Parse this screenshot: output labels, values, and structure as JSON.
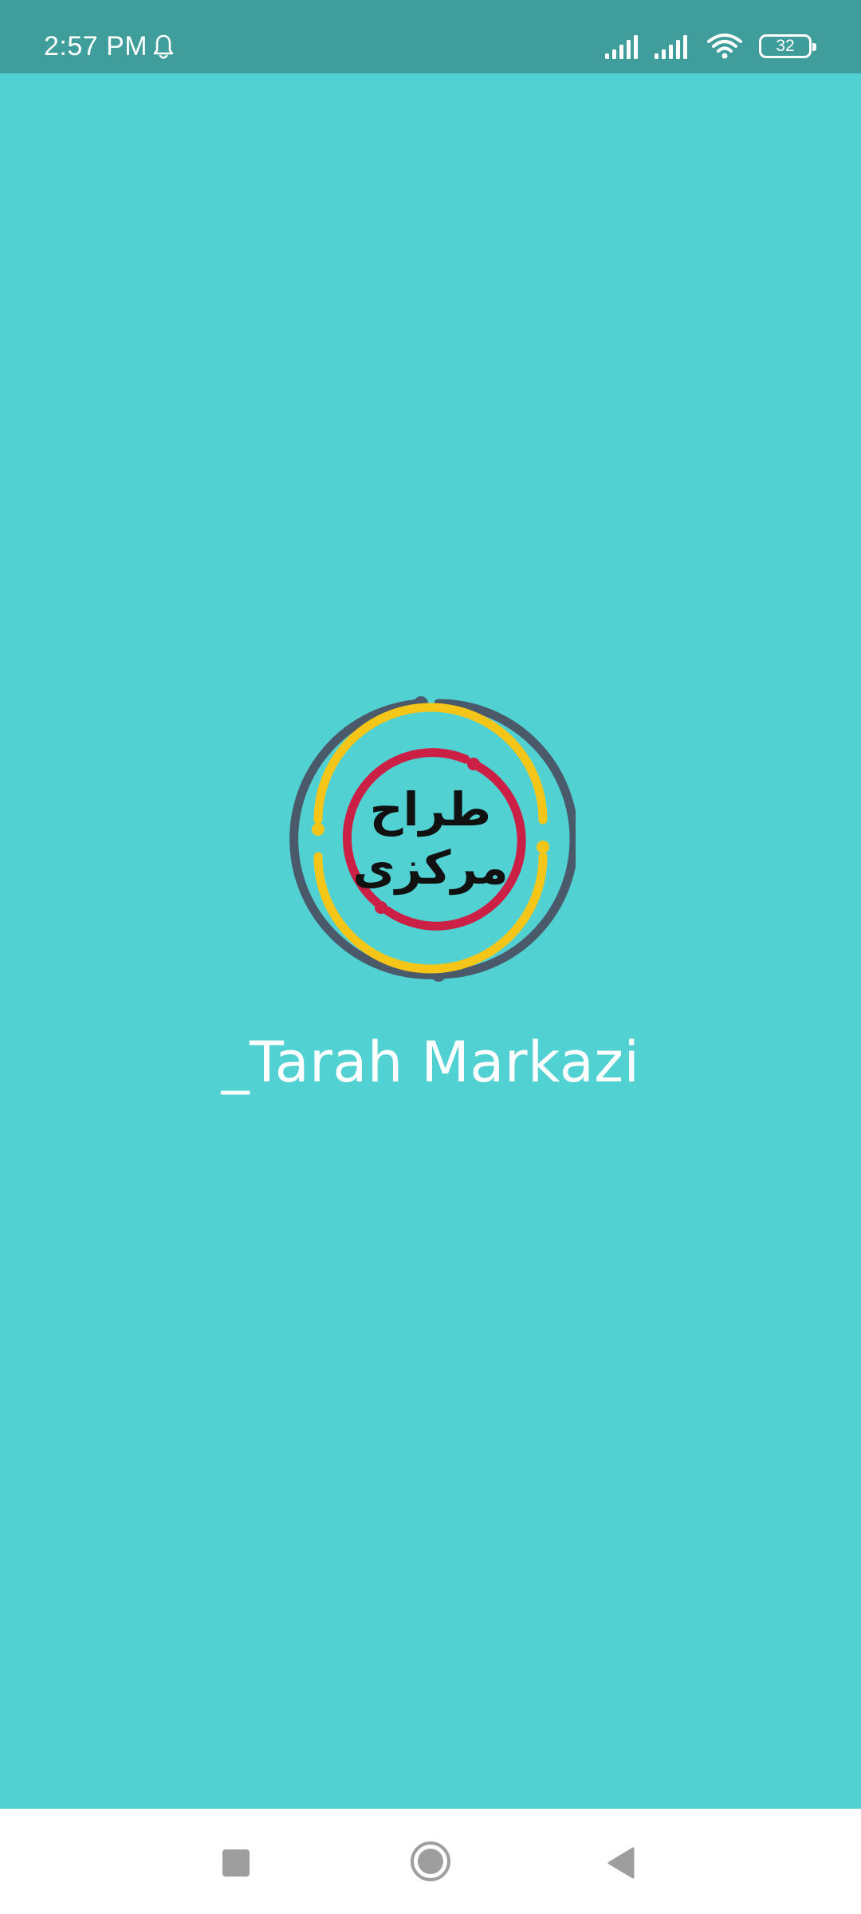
{
  "status_bar": {
    "time": "2:57 PM",
    "battery": "32",
    "icons": [
      "bell-icon",
      "signal-icon",
      "signal-icon",
      "wifi-icon",
      "battery-icon"
    ]
  },
  "splash": {
    "logo_text_line1": "طراح",
    "logo_text_line2": "مرکزی",
    "app_name": "_Tarah Markazi"
  },
  "nav_bar": {
    "icons": [
      "recent-apps-icon",
      "home-icon",
      "back-icon"
    ]
  },
  "colors": {
    "background": "#52d1d3",
    "status_bar": "#3f9e9c",
    "ring_outer": "#4a5a6a",
    "ring_middle": "#f5c518",
    "ring_inner": "#cc1f45",
    "nav_icons": "#9e9e9e"
  }
}
